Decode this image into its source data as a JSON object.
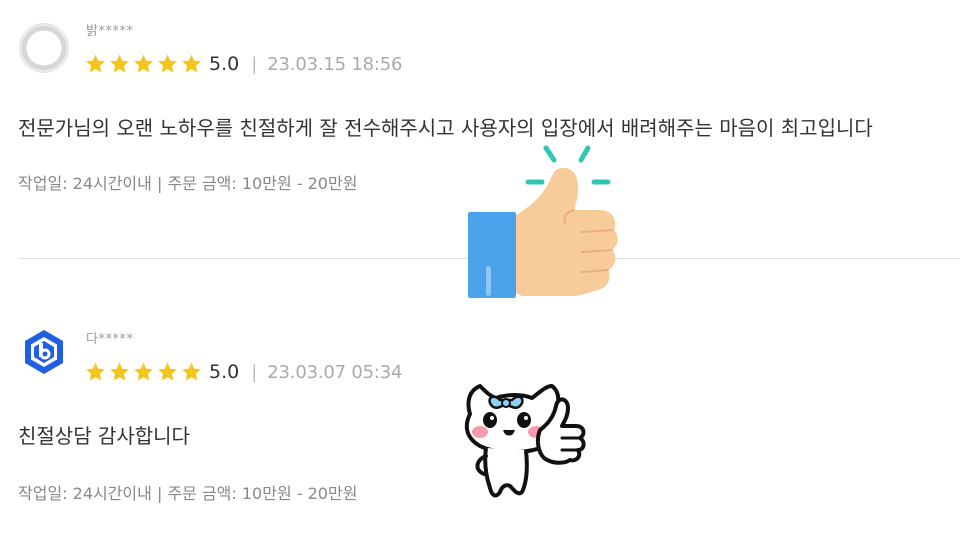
{
  "reviews": [
    {
      "username": "밝*****",
      "rating": 5.0,
      "rating_text": "5.0",
      "separator": "|",
      "date": "23.03.15 18:56",
      "body": "전문가님의  오랜 노하우를 친절하게 잘 전수해주시고 사용자의 입장에서 배려해주는 마음이 최고입니다",
      "meta": "작업일: 24시간이내 | 주문 금액: 10만원 - 20만원",
      "avatar": "default-user-avatar-icon"
    },
    {
      "username": "다*****",
      "rating": 5.0,
      "rating_text": "5.0",
      "separator": "|",
      "date": "23.03.07 05:34",
      "body": "친절상담 감사합니다",
      "meta": "작업일: 24시간이내 | 주문 금액: 10만원 - 20만원",
      "avatar": "blue-hexagon-logo-avatar-icon"
    }
  ],
  "decorations": {
    "thumbs_up": "thumbs-up-icon",
    "cat_thumbs_up": "cat-thumbs-up-icon"
  },
  "colors": {
    "star": "#f5c518",
    "divider": "#e2e2e2",
    "logo_blue": "#1f5fe0",
    "sleeve": "#4aa3ea",
    "hand": "#f8cc9a",
    "sparkle": "#2fc6b6"
  }
}
